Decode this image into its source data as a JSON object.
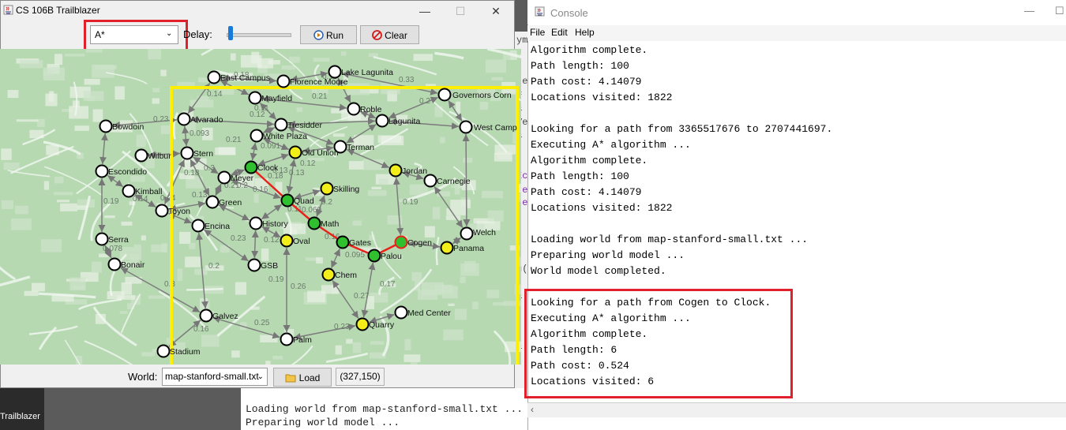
{
  "taskbar": {
    "label": "Trailblazer"
  },
  "ide": {
    "console_lines": [
      "Loading world from map-stanford-small.txt ...",
      "Preparing world model ..."
    ],
    "fragments": [
      "ym",
      "te",
      "=",
      "&",
      "Ve",
      "&",
      "Ec",
      "re",
      "te",
      "g(",
      "&",
      "&"
    ]
  },
  "trailblazer": {
    "title": "CS 106B Trailblazer",
    "minimize": "—",
    "maximize": "☐",
    "close": "✕",
    "algorithm": "A*",
    "delay_label": "Delay:",
    "delay_value": 0.05,
    "run_label": "Run",
    "clear_label": "Clear",
    "world_label": "World:",
    "world_file": "map-stanford-small.txt",
    "load_label": "Load",
    "coords": "(327,150)",
    "highlight_color": "#ffee00",
    "path_color": "#e8221b"
  },
  "map": {
    "nodes": [
      {
        "id": "East Campus",
        "label": "East Campus",
        "state": "white"
      },
      {
        "id": "Florence Moore",
        "label": "Florence Moore",
        "state": "white"
      },
      {
        "id": "Lake Lagunita",
        "label": "Lake Lagunita",
        "state": "white"
      },
      {
        "id": "Governors Corn",
        "label": "Governors Corn",
        "state": "white"
      },
      {
        "id": "Mayfield",
        "label": "Mayfield",
        "state": "white"
      },
      {
        "id": "Roble",
        "label": "Roble",
        "state": "white"
      },
      {
        "id": "Alvarado",
        "label": "Alvarado",
        "state": "white"
      },
      {
        "id": "Bowdoin",
        "label": "Bowdoin",
        "state": "white"
      },
      {
        "id": "Tresidder",
        "label": "Tresidder",
        "state": "white"
      },
      {
        "id": "Lagunita",
        "label": "Lagunita",
        "state": "white"
      },
      {
        "id": "West Camp",
        "label": "West Camp",
        "state": "white"
      },
      {
        "id": "White Plaza",
        "label": "White Plaza",
        "state": "white"
      },
      {
        "id": "Terman",
        "label": "Terman",
        "state": "white"
      },
      {
        "id": "Wilbur",
        "label": "Wilbur",
        "state": "white"
      },
      {
        "id": "Stern",
        "label": "Stern",
        "state": "white"
      },
      {
        "id": "Old Union",
        "label": "Old Union",
        "state": "yellow"
      },
      {
        "id": "Escondido",
        "label": "Escondido",
        "state": "white"
      },
      {
        "id": "Clock",
        "label": "Clock",
        "state": "path"
      },
      {
        "id": "Jordan",
        "label": "Jordan",
        "state": "yellow"
      },
      {
        "id": "Meyer",
        "label": "Meyer",
        "state": "white"
      },
      {
        "id": "Carnegie",
        "label": "Carnegie",
        "state": "white"
      },
      {
        "id": "Skilling",
        "label": "Skilling",
        "state": "yellow"
      },
      {
        "id": "Kimball",
        "label": "Kimball",
        "state": "white"
      },
      {
        "id": "Quad",
        "label": "Quad",
        "state": "path"
      },
      {
        "id": "Green",
        "label": "Green",
        "state": "white"
      },
      {
        "id": "Toyon",
        "label": "Toyon",
        "state": "white"
      },
      {
        "id": "Encina",
        "label": "Encina",
        "state": "white"
      },
      {
        "id": "History",
        "label": "History",
        "state": "white"
      },
      {
        "id": "Math",
        "label": "Math",
        "state": "path"
      },
      {
        "id": "Welch",
        "label": "Welch",
        "state": "white"
      },
      {
        "id": "Serra",
        "label": "Serra",
        "state": "white"
      },
      {
        "id": "Oval",
        "label": "Oval",
        "state": "yellow"
      },
      {
        "id": "Gates",
        "label": "Gates",
        "state": "path"
      },
      {
        "id": "Cogen",
        "label": "Cogen",
        "state": "path-start"
      },
      {
        "id": "Panama",
        "label": "Panama",
        "state": "yellow"
      },
      {
        "id": "Palou",
        "label": "Palou",
        "state": "path"
      },
      {
        "id": "GSB",
        "label": "GSB",
        "state": "white"
      },
      {
        "id": "Bonair",
        "label": "Bonair",
        "state": "white"
      },
      {
        "id": "Chem",
        "label": "Chem",
        "state": "yellow"
      },
      {
        "id": "Med Center",
        "label": "Med Center",
        "state": "white"
      },
      {
        "id": "Galvez",
        "label": "Galvez",
        "state": "white"
      },
      {
        "id": "Quarry",
        "label": "Quarry",
        "state": "yellow"
      },
      {
        "id": "Palm",
        "label": "Palm",
        "state": "white"
      },
      {
        "id": "Stadium",
        "label": "Stadium",
        "state": "white"
      }
    ],
    "edge_labels": [
      "0.14",
      "0.11",
      "0.18",
      "0.33",
      "0.21",
      "0.11",
      "0.2",
      "0.23",
      "0.12",
      "0.093",
      "0.21",
      "0.091",
      "0.13",
      "0.18",
      "0.3",
      "0.21",
      "0.12",
      "0.13",
      "0.2",
      "0.14",
      "0.16",
      "0.18",
      "0.069",
      "0.2",
      "0.19",
      "0.24",
      "0.13",
      "0.11",
      "0.19",
      "0.078",
      "0.23",
      "0.12",
      "0.16",
      "0.095",
      "0.2",
      "0.26",
      "0.27",
      "0.17",
      "0.19",
      "0.3",
      "0.16",
      "0.25",
      "0.23"
    ],
    "path": [
      "Cogen",
      "Palou",
      "Gates",
      "Math",
      "Quad",
      "Clock"
    ]
  },
  "console": {
    "title": "Console",
    "minimize": "—",
    "maximize": "☐",
    "menu": [
      "File",
      "Edit",
      "Help"
    ],
    "lines": [
      "Algorithm complete.",
      "Path length: 100",
      "Path cost: 4.14079",
      "Locations visited: 1822",
      "",
      "Looking for a path from 3365517676 to 2707441697.",
      "Executing A* algorithm ...",
      "Algorithm complete.",
      "Path length: 100",
      "Path cost: 4.14079",
      "Locations visited: 1822",
      "",
      "Loading world from map-stanford-small.txt ...",
      "Preparing world model ...",
      "World model completed.",
      "",
      "Looking for a path from Cogen to Clock.",
      "Executing A* algorithm ...",
      "Algorithm complete.",
      "Path length: 6",
      "Path cost: 0.524",
      "Locations visited: 6"
    ],
    "highlight_color": "#e0202b"
  }
}
